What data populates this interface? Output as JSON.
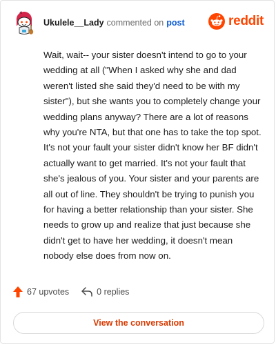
{
  "header": {
    "username": "Ukulele__Lady",
    "commented_text": "commented on",
    "post_link": "post",
    "brand": "reddit",
    "avatar_icon": "redditor-avatar-icon",
    "logo_icon": "reddit-logo-icon"
  },
  "comment": {
    "body": "Wait, wait-- your sister doesn't intend to go to your wedding at all (\"When I asked why she and dad weren't listed she said they'd need to be with my sister\"), but she wants you to completely change your wedding plans anyway? There are a lot of reasons why you're NTA, but that one has to take the top spot. It's not your fault your sister didn't know her BF didn't actually want to get married. It's not your fault that she's jealous of you. Your sister and your parents are all out of line. They shouldn't be trying to punish you for having a better relationship than your sister. She needs to grow up and realize that just because she didn't get to have her wedding, it doesn't mean nobody else does from now on."
  },
  "stats": {
    "upvotes": "67 upvotes",
    "replies": "0 replies",
    "upvote_icon": "upvote-arrow-icon",
    "reply_icon": "reply-icon"
  },
  "actions": {
    "view_conversation": "View the conversation"
  },
  "colors": {
    "brand": "#ff4500",
    "link": "#0b5bd3",
    "button_text": "#d93900"
  }
}
